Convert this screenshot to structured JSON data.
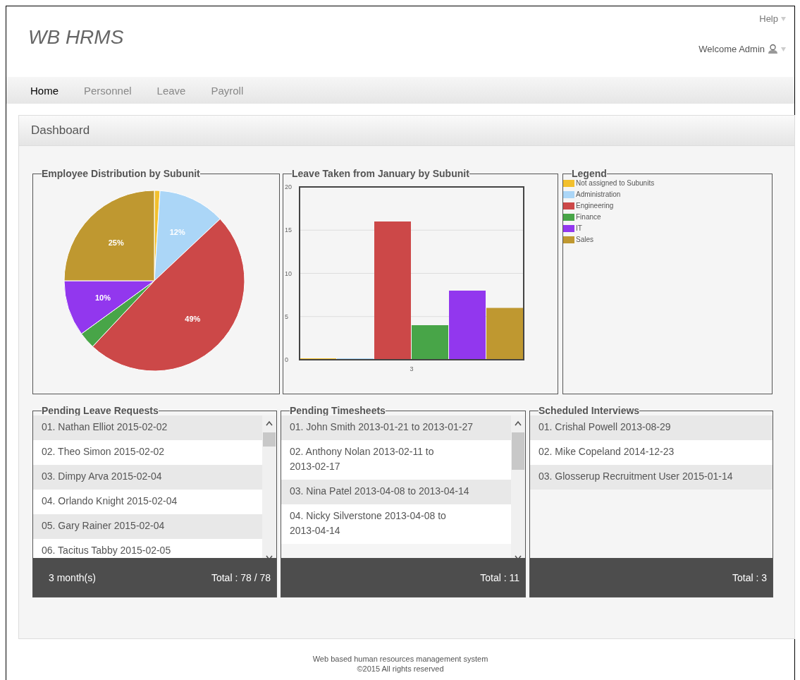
{
  "header": {
    "logo": "WB HRMS",
    "help": "Help",
    "welcome": "Welcome Admin"
  },
  "nav": [
    {
      "label": "Home",
      "selected": true
    },
    {
      "label": "Personnel",
      "selected": false
    },
    {
      "label": "Leave",
      "selected": false
    },
    {
      "label": "Payroll",
      "selected": false
    }
  ],
  "dashboard": {
    "title": "Dashboard",
    "employee_distribution": {
      "title": "Employee Distribution by Subunit",
      "chart_data": {
        "type": "pie",
        "series": [
          {
            "colors": [
              "#f2c02e",
              "#abd6f7",
              "#cc4848",
              "#48a548",
              "#9237ee",
              "#bf9830"
            ],
            "values": [
              1,
              12,
              49,
              3,
              10,
              25
            ]
          }
        ],
        "value_labels": [
          null,
          "12%",
          "49%",
          null,
          "10%",
          "25%"
        ]
      }
    },
    "leave_taken": {
      "title": "Leave Taken from January by Subunit",
      "chart_data": {
        "type": "bar",
        "categories": [
          "3"
        ],
        "ylim": [
          0,
          20
        ],
        "yticks": [
          0,
          5,
          10,
          15,
          20
        ],
        "grid": true,
        "series": [
          {
            "name": "Not assigned to Subunits",
            "color": "#f2c02e",
            "values": [
              0
            ]
          },
          {
            "name": "Administration",
            "color": "#abd6f7",
            "values": [
              0
            ]
          },
          {
            "name": "Engineering",
            "color": "#cc4848",
            "values": [
              16
            ]
          },
          {
            "name": "Finance",
            "color": "#48a548",
            "values": [
              4
            ]
          },
          {
            "name": "IT",
            "color": "#9237ee",
            "values": [
              8
            ]
          },
          {
            "name": "Sales",
            "color": "#bf9830",
            "values": [
              6
            ]
          }
        ]
      }
    },
    "legend": {
      "title": "Legend"
    },
    "lists": [
      {
        "title": "Pending Leave Requests",
        "scrollable": true,
        "items": [
          "01. Nathan Elliot 2015-02-02",
          "02. Theo Simon 2015-02-02",
          "03. Dimpy Arva 2015-02-04",
          "04. Orlando Knight 2015-02-04",
          "05. Gary Rainer 2015-02-04",
          "06. Tacitus Tabby 2015-02-05"
        ],
        "footer_left": "3 month(s)",
        "footer_right": "Total : 78 / 78"
      },
      {
        "title": "Pending Timesheets",
        "scrollable": true,
        "items": [
          "01. John Smith 2013-01-21 to 2013-01-27",
          "02. Anthony Nolan 2013-02-11 to 2013-02-17",
          "03. Nina Patel 2013-04-08 to 2013-04-14",
          "04. Nicky Silverstone 2013-04-08 to 2013-04-14"
        ],
        "footer_right": "Total : 11"
      },
      {
        "title": "Scheduled Interviews",
        "scrollable": false,
        "items": [
          "01. Crishal Powell 2013-08-29",
          "02. Mike Copeland 2014-12-23",
          "03. Glosserup Recruitment User 2015-01-14"
        ],
        "footer_right": "Total : 3"
      }
    ]
  },
  "footer": [
    "Web based human resources management system",
    "©2015 All rights reserved"
  ]
}
